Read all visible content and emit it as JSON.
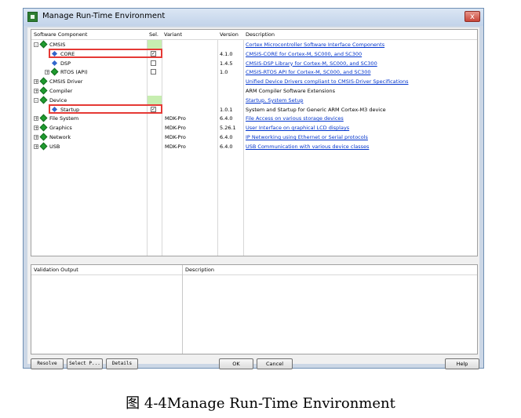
{
  "window": {
    "title": "Manage Run-Time Environment",
    "close_glyph": "x"
  },
  "grid": {
    "headers": {
      "component": "Software Component",
      "sel": "Sel.",
      "variant": "Variant",
      "version": "Version",
      "description": "Description"
    },
    "rows": [
      {
        "label": "CMSIS",
        "expander": "-",
        "icon": "green-diamond-icon",
        "sel": "",
        "variant": "",
        "version": "",
        "description": "Cortex Microcontroller Software Interface Components",
        "link": true
      },
      {
        "label": "CORE",
        "expander": "",
        "icon": "blue-diamond-icon",
        "sel": "✓",
        "variant": "",
        "version": "4.1.0",
        "description": "CMSIS-CORE for Cortex-M, SC000, and SC300",
        "link": true
      },
      {
        "label": "DSP",
        "expander": "",
        "icon": "blue-diamond-icon",
        "sel": "",
        "variant": "",
        "version": "1.4.5",
        "description": "CMSIS-DSP Library for Cortex-M, SC000, and SC300",
        "link": true
      },
      {
        "label": "RTOS (API)",
        "expander": "+",
        "icon": "green-diamond-icon",
        "sel": "",
        "variant": "",
        "version": "1.0",
        "description": "CMSIS-RTOS API for Cortex-M, SC000, and SC300",
        "link": true
      },
      {
        "label": "CMSIS Driver",
        "expander": "+",
        "icon": "green-diamond-icon",
        "sel": "",
        "variant": "",
        "version": "",
        "description": "Unified Device Drivers compliant to CMSIS-Driver Specifications",
        "link": true
      },
      {
        "label": "Compiler",
        "expander": "+",
        "icon": "green-diamond-icon",
        "sel": "",
        "variant": "",
        "version": "",
        "description": "ARM Compiler Software Extensions",
        "link": false
      },
      {
        "label": "Device",
        "expander": "-",
        "icon": "green-diamond-icon",
        "sel": "",
        "variant": "",
        "version": "",
        "description": "Startup, System Setup",
        "link": true
      },
      {
        "label": "Startup",
        "expander": "",
        "icon": "blue-diamond-icon",
        "sel": "✓",
        "variant": "",
        "version": "1.0.1",
        "description": "System and Startup for Generic ARM Cortex-M3 device",
        "link": false
      },
      {
        "label": "File System",
        "expander": "+",
        "icon": "green-diamond-icon",
        "sel": "",
        "variant": "MDK-Pro",
        "version": "6.4.0",
        "description": "File Access on various storage devices",
        "link": true
      },
      {
        "label": "Graphics",
        "expander": "+",
        "icon": "green-diamond-icon",
        "sel": "",
        "variant": "MDK-Pro",
        "version": "5.26.1",
        "description": "User Interface on graphical LCD displays",
        "link": true
      },
      {
        "label": "Network",
        "expander": "+",
        "icon": "green-diamond-icon",
        "sel": "",
        "variant": "MDK-Pro",
        "version": "6.4.0",
        "description": "IP Networking using Ethernet or Serial protocols",
        "link": true
      },
      {
        "label": "USB",
        "expander": "+",
        "icon": "green-diamond-icon",
        "sel": "",
        "variant": "MDK-Pro",
        "version": "6.4.0",
        "description": "USB Communication with various device classes",
        "link": true
      }
    ]
  },
  "validation": {
    "output_header": "Validation Output",
    "description_header": "Description"
  },
  "buttons": {
    "resolve": "Resolve",
    "select": "Select P...",
    "details": "Details",
    "ok": "OK",
    "cancel": "Cancel",
    "help": "Help"
  },
  "caption": "图 4-4Manage Run-Time Environment",
  "colors": {
    "selected_green": "#c7eeb0",
    "highlight_red": "#e53935",
    "link_blue": "#0033cc"
  }
}
